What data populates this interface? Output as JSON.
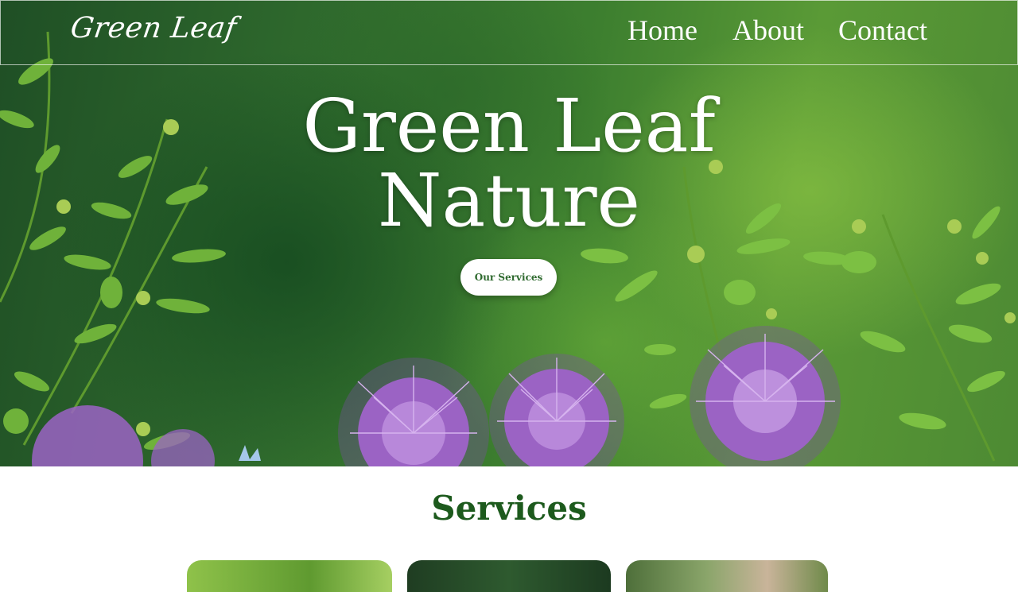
{
  "brand": {
    "name": "Green Leaf"
  },
  "nav": {
    "items": [
      {
        "label": "Home"
      },
      {
        "label": "About"
      },
      {
        "label": "Contact"
      }
    ]
  },
  "hero": {
    "title_line1": "Green Leaf",
    "title_line2": "Nature",
    "cta_label": "Our Services",
    "background": "garden-photo-allium-flowers"
  },
  "services": {
    "title": "Services",
    "cards": [
      {
        "image": "green-foliage-photo"
      },
      {
        "image": "dark-forest-photo"
      },
      {
        "image": "garden-person-photo"
      }
    ]
  },
  "colors": {
    "accent_green": "#1d5a1d",
    "cta_text": "#2f6a2f",
    "flower_purple": "#9b63c4"
  }
}
